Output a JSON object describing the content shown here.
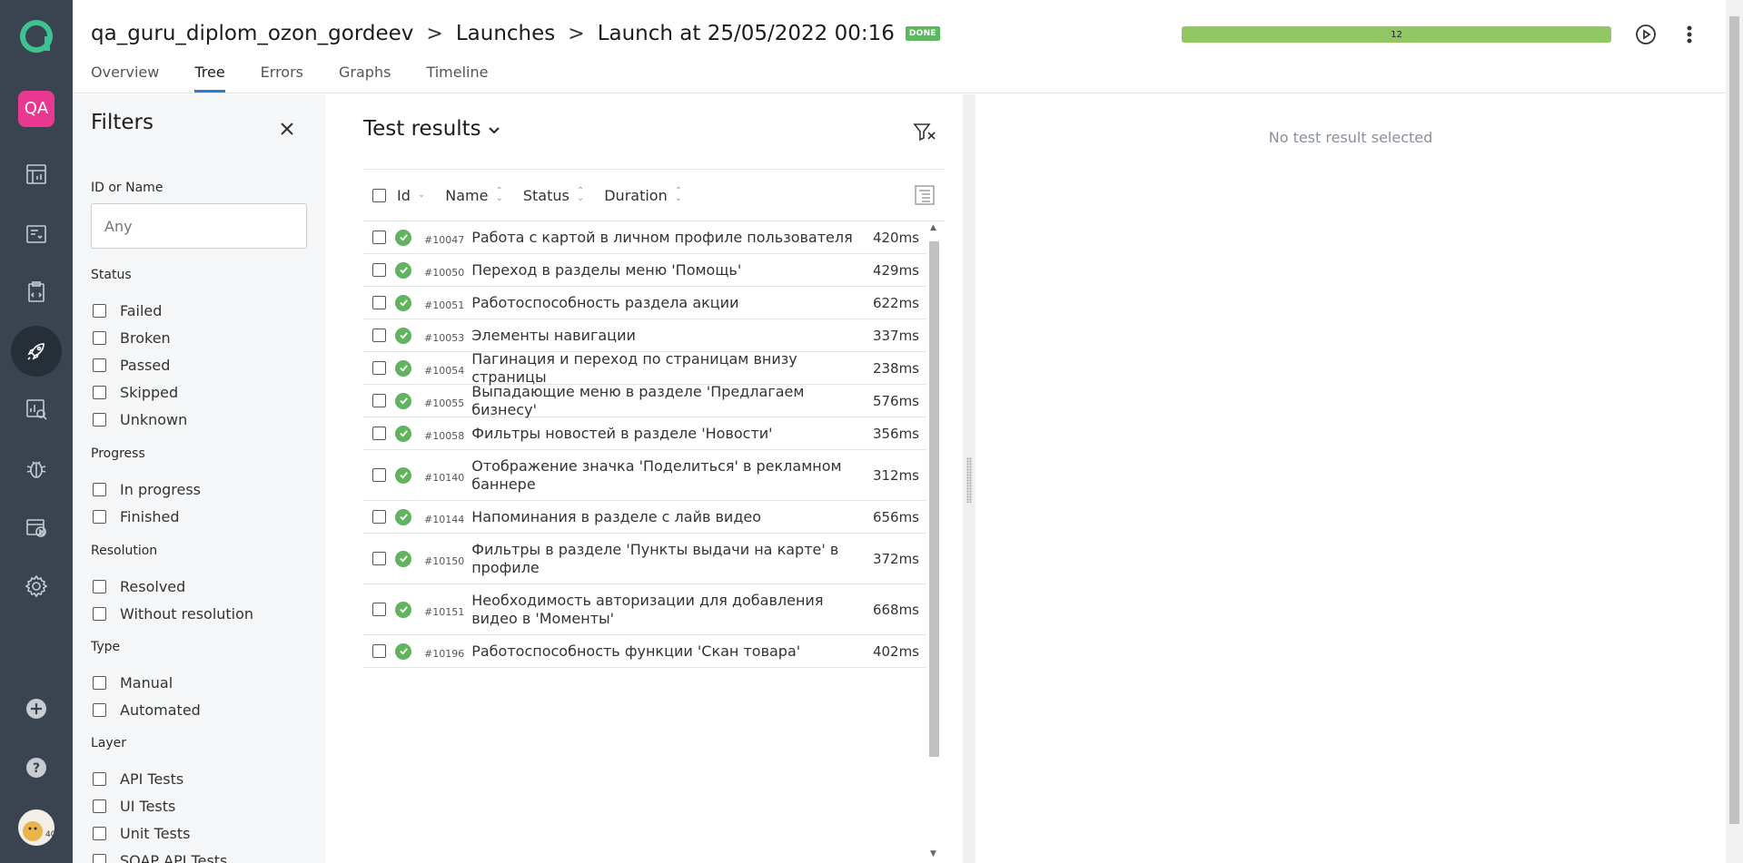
{
  "header": {
    "project": "qa_guru_diplom_ozon_gordeev",
    "separator": ">",
    "launches": "Launches",
    "launch_title": "Launch at 25/05/2022 00:16",
    "status_badge": "DONE",
    "progress_label": "12",
    "tabs": [
      {
        "label": "Overview",
        "active": false
      },
      {
        "label": "Tree",
        "active": true
      },
      {
        "label": "Errors",
        "active": false
      },
      {
        "label": "Graphs",
        "active": false
      },
      {
        "label": "Timeline",
        "active": false
      }
    ]
  },
  "rail": {
    "project_badge": "QA",
    "icons": [
      "dashboards-icon",
      "test-cases-icon",
      "test-plans-icon",
      "launches-icon",
      "analytics-icon",
      "defects-icon",
      "jobs-icon",
      "settings-icon"
    ],
    "active": "launches-icon",
    "colors": {
      "rail_bg": "#3a4450",
      "project_badge_bg": "#e8388f"
    }
  },
  "filters": {
    "title": "Filters",
    "id_or_name_label": "ID or Name",
    "id_or_name_placeholder": "Any",
    "sections": [
      {
        "label": "Status",
        "options": [
          "Failed",
          "Broken",
          "Passed",
          "Skipped",
          "Unknown"
        ]
      },
      {
        "label": "Progress",
        "options": [
          "In progress",
          "Finished"
        ]
      },
      {
        "label": "Resolution",
        "options": [
          "Resolved",
          "Without resolution"
        ]
      },
      {
        "label": "Type",
        "options": [
          "Manual",
          "Automated"
        ]
      },
      {
        "label": "Layer",
        "options": [
          "API Tests",
          "UI Tests",
          "Unit Tests",
          "SOAP API Tests"
        ]
      }
    ]
  },
  "results": {
    "title": "Test results",
    "columns": {
      "id": "Id",
      "name": "Name",
      "status": "Status",
      "duration": "Duration"
    },
    "rows": [
      {
        "id": "#10047",
        "name": "Работа с картой в личном профиле пользователя",
        "duration": "420ms",
        "status": "passed"
      },
      {
        "id": "#10050",
        "name": "Переход в разделы меню 'Помощь'",
        "duration": "429ms",
        "status": "passed"
      },
      {
        "id": "#10051",
        "name": "Работоспособность раздела акции",
        "duration": "622ms",
        "status": "passed"
      },
      {
        "id": "#10053",
        "name": "Элементы навигации",
        "duration": "337ms",
        "status": "passed"
      },
      {
        "id": "#10054",
        "name": "Пагинация и переход по страницам внизу страницы",
        "duration": "238ms",
        "status": "passed"
      },
      {
        "id": "#10055",
        "name": "Выпадающие меню в разделе 'Предлагаем бизнесу'",
        "duration": "576ms",
        "status": "passed"
      },
      {
        "id": "#10058",
        "name": "Фильтры новостей в разделе 'Новости'",
        "duration": "356ms",
        "status": "passed"
      },
      {
        "id": "#10140",
        "name": "Отображение значка 'Поделиться' в рекламном баннере",
        "duration": "312ms",
        "status": "passed"
      },
      {
        "id": "#10144",
        "name": "Напоминания в разделе с лайв видео",
        "duration": "656ms",
        "status": "passed"
      },
      {
        "id": "#10150",
        "name": "Фильтры в разделе 'Пункты выдачи на карте' в профиле",
        "duration": "372ms",
        "status": "passed"
      },
      {
        "id": "#10151",
        "name": "Необходимость авторизации для добавления видео в 'Моменты'",
        "duration": "668ms",
        "status": "passed"
      },
      {
        "id": "#10196",
        "name": "Работоспособность функции 'Скан товара'",
        "duration": "402ms",
        "status": "passed"
      }
    ]
  },
  "detail": {
    "empty_text": "No test result selected"
  },
  "colors": {
    "accent": "#2a7bd8",
    "passed": "#61b35e",
    "progress": "#91c763",
    "done_badge": "#5cb85c"
  }
}
